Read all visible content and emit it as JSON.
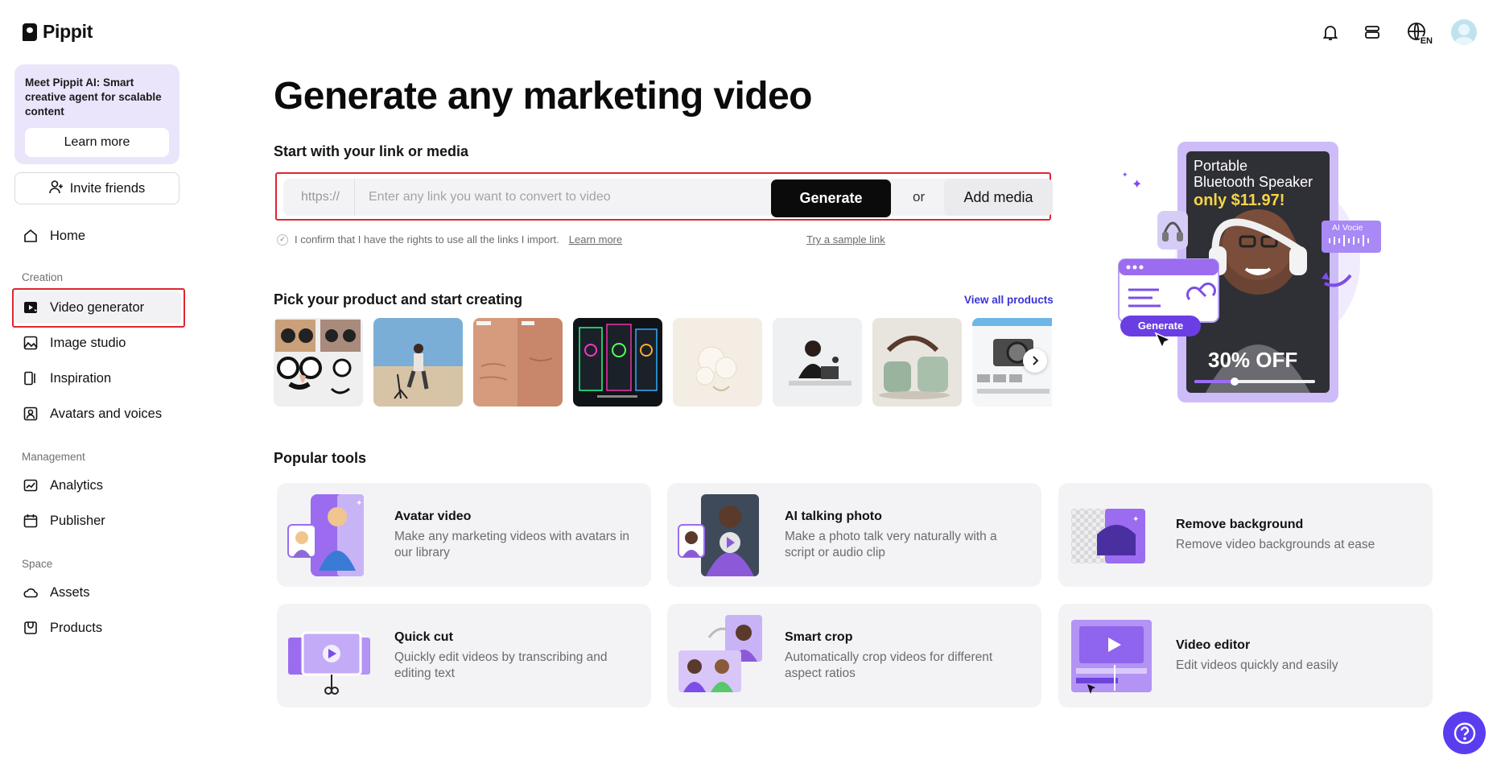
{
  "app": {
    "name": "Pippit"
  },
  "sidebar": {
    "promo": {
      "text": "Meet Pippit AI: Smart creative agent for scalable content",
      "button": "Learn more"
    },
    "invite": "Invite friends",
    "home": "Home",
    "sections": {
      "creation": "Creation",
      "management": "Management",
      "space": "Space"
    },
    "creation_items": [
      "Video generator",
      "Image studio",
      "Inspiration",
      "Avatars and voices"
    ],
    "management_items": [
      "Analytics",
      "Publisher"
    ],
    "space_items": [
      "Assets",
      "Products"
    ]
  },
  "header": {
    "language": "EN"
  },
  "main": {
    "title": "Generate any marketing video",
    "link_section": {
      "heading": "Start with your link or media",
      "prefix": "https://",
      "placeholder": "Enter any link you want to convert to video",
      "generate": "Generate",
      "or": "or",
      "add_media": "Add media",
      "confirm": "I confirm that I have the rights to use all the links I import.",
      "confirm_link": "Learn more",
      "sample": "Try a sample link"
    },
    "products": {
      "heading": "Pick your product and start creating",
      "view_all": "View all products"
    },
    "popular": {
      "heading": "Popular tools",
      "tools": [
        {
          "name": "Avatar video",
          "desc": "Make any marketing videos with avatars in our library"
        },
        {
          "name": "AI talking photo",
          "desc": "Make a photo talk very naturally with a script or audio clip"
        },
        {
          "name": "Remove background",
          "desc": "Remove video backgrounds at ease"
        },
        {
          "name": "Quick cut",
          "desc": "Quickly edit videos by transcribing and editing text"
        },
        {
          "name": "Smart crop",
          "desc": "Automatically crop videos for different aspect ratios"
        },
        {
          "name": "Video editor",
          "desc": "Edit videos quickly and easily"
        }
      ]
    },
    "hero": {
      "line1": "Portable",
      "line2": "Bluetooth Speaker",
      "price": "only $11.97!",
      "discount": "30% OFF",
      "ai_voice": "AI Vocie",
      "generate": "Generate"
    }
  },
  "colors": {
    "accent": "#5b3df0",
    "outline": "#e0262f",
    "lavender": "#eae5fb"
  }
}
